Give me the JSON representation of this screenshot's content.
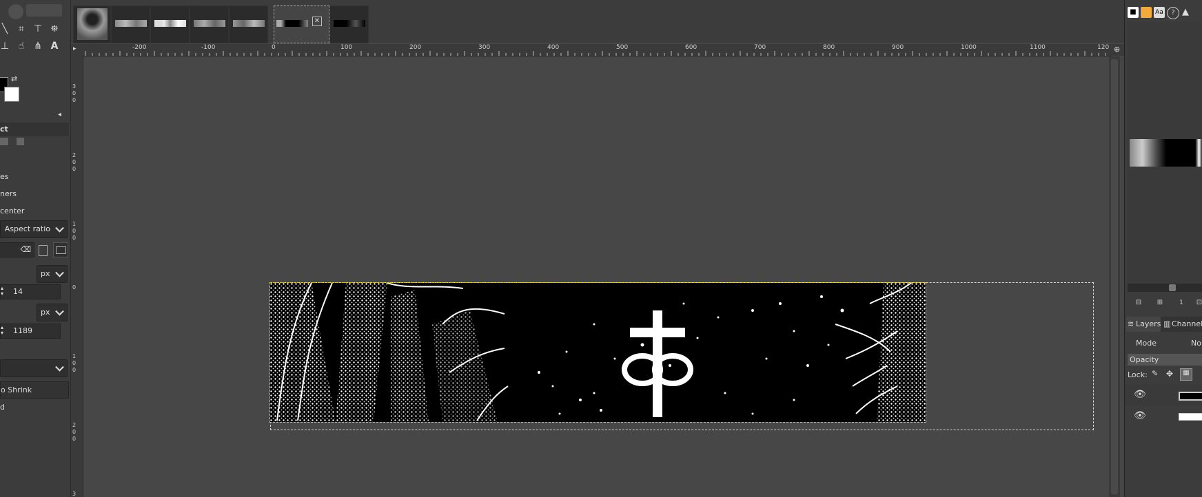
{
  "toolbox": {
    "tool_options": {
      "title": "ct",
      "option_1": "es",
      "option_2": "ners",
      "option_3": "center",
      "fixed_mode": "Aspect ratio",
      "unit_1": "px",
      "position_y": "14",
      "unit_2": "px",
      "size_x": "1189",
      "shrink_button": "o Shrink",
      "last_option": "d"
    }
  },
  "ruler": {
    "h_labels": [
      "-200",
      "-100",
      "0",
      "100",
      "200",
      "300",
      "400",
      "500",
      "600",
      "700",
      "800",
      "900",
      "1000",
      "1100",
      "120"
    ],
    "v_labels": [
      "3",
      "0",
      "0",
      "2",
      "0",
      "0",
      "1",
      "0",
      "0",
      "0",
      "1",
      "0",
      "0",
      "2",
      "0",
      "0",
      "3"
    ]
  },
  "dock": {
    "tab_layers": "Layers",
    "tab_channels": "Channels",
    "mode_label": "Mode",
    "mode_value": "Nor",
    "opacity_label": "Opacity",
    "lock_label": "Lock:"
  },
  "icons": [
    "paths-icon",
    "crop-icon",
    "transform-icon",
    "bucket-fill-icon",
    "clone-icon",
    "smudge-icon",
    "path-tool-icon",
    "text-tool-icon",
    "swap-colors-icon",
    "eye-icon",
    "close-icon"
  ]
}
